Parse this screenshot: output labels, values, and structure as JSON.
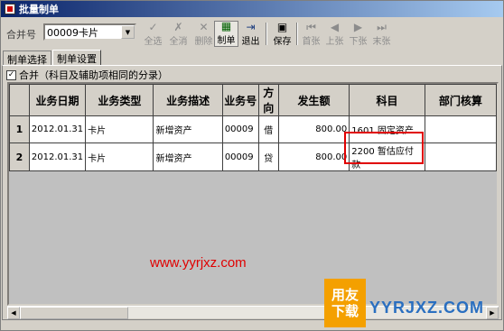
{
  "window": {
    "title": "批量制单"
  },
  "toolbar": {
    "merge_label": "合并号",
    "merge_value": "00009卡片",
    "buttons": [
      {
        "label": "全选",
        "icon": "select-all-icon",
        "enabled": false
      },
      {
        "label": "全消",
        "icon": "deselect-all-icon",
        "enabled": false
      },
      {
        "label": "删除",
        "icon": "delete-icon",
        "enabled": false
      },
      {
        "label": "制单",
        "icon": "make-voucher-icon",
        "enabled": true
      },
      {
        "label": "退出",
        "icon": "exit-icon",
        "enabled": true
      },
      {
        "label": "保存",
        "icon": "save-icon",
        "enabled": true
      },
      {
        "label": "首张",
        "icon": "first-icon",
        "enabled": false
      },
      {
        "label": "上张",
        "icon": "prev-icon",
        "enabled": false
      },
      {
        "label": "下张",
        "icon": "next-icon",
        "enabled": false
      },
      {
        "label": "末张",
        "icon": "last-icon",
        "enabled": false
      }
    ]
  },
  "tabs": [
    {
      "label": "制单选择",
      "selected": false
    },
    {
      "label": "制单设置",
      "selected": true
    }
  ],
  "merge_option": {
    "label": "合并（科目及辅助项相同的分录）",
    "checked": true
  },
  "table": {
    "headers": [
      "",
      "业务日期",
      "业务类型",
      "业务描述",
      "业务号",
      "方向",
      "发生额",
      "科目",
      "部门核算"
    ],
    "rows": [
      {
        "num": "1",
        "date": "2012.01.31",
        "type": "卡片",
        "desc": "新增资产",
        "biz_no": "00009",
        "dir": "借",
        "amount": "800.00",
        "subject": "1601    固定资产",
        "dept": ""
      },
      {
        "num": "2",
        "date": "2012.01.31",
        "type": "卡片",
        "desc": "新增资产",
        "biz_no": "00009",
        "dir": "贷",
        "amount": "800.00",
        "subject": "2200    暂估应付款",
        "dept": ""
      }
    ]
  },
  "watermark": {
    "url": "www.yyrjxz.com",
    "logo_line1": "用友",
    "logo_line2": "下载",
    "logo_site": "YYRJXZ.COM"
  },
  "colors": {
    "highlight": "#e00000",
    "title_bar": "#0a246a"
  }
}
